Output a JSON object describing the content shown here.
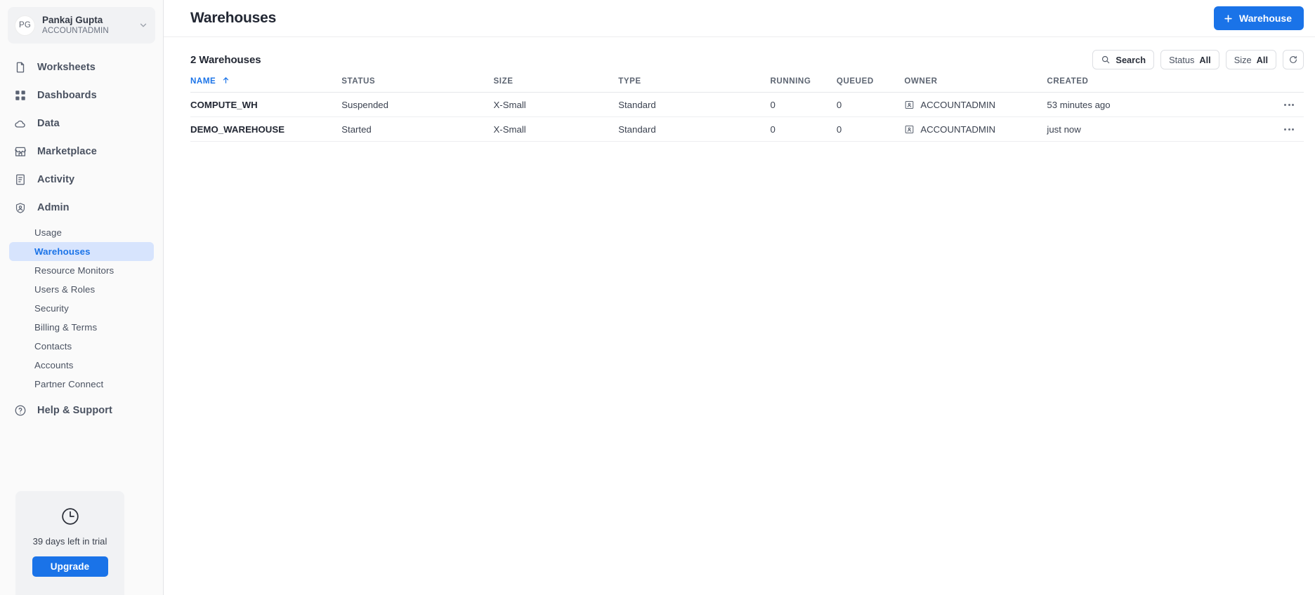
{
  "sidebar": {
    "account": {
      "initials": "PG",
      "name": "Pankaj Gupta",
      "role": "ACCOUNTADMIN",
      "chevron_icon": "chevron-down-icon"
    },
    "nav": [
      {
        "label": "Worksheets",
        "icon": "document-icon"
      },
      {
        "label": "Dashboards",
        "icon": "grid-icon"
      },
      {
        "label": "Data",
        "icon": "cloud-icon"
      },
      {
        "label": "Marketplace",
        "icon": "storefront-icon"
      },
      {
        "label": "Activity",
        "icon": "list-document-icon"
      },
      {
        "label": "Admin",
        "icon": "shield-user-icon"
      }
    ],
    "subnav": [
      {
        "label": "Usage",
        "active": false
      },
      {
        "label": "Warehouses",
        "active": true
      },
      {
        "label": "Resource Monitors",
        "active": false
      },
      {
        "label": "Users & Roles",
        "active": false
      },
      {
        "label": "Security",
        "active": false
      },
      {
        "label": "Billing & Terms",
        "active": false
      },
      {
        "label": "Contacts",
        "active": false
      },
      {
        "label": "Accounts",
        "active": false
      },
      {
        "label": "Partner Connect",
        "active": false
      }
    ],
    "help": {
      "label": "Help & Support",
      "icon": "question-circle-icon"
    },
    "trial": {
      "icon": "clock-icon",
      "text": "39 days left in trial",
      "button_label": "Upgrade"
    }
  },
  "header": {
    "title": "Warehouses",
    "add_button_label": "Warehouse",
    "add_button_icon": "plus-icon"
  },
  "toolbar": {
    "count_label": "2 Warehouses",
    "search_label": "Search",
    "search_icon": "search-icon",
    "status_filter_label": "Status",
    "status_filter_value": "All",
    "size_filter_label": "Size",
    "size_filter_value": "All",
    "refresh_icon": "refresh-icon"
  },
  "table": {
    "columns": [
      {
        "key": "name",
        "label": "NAME",
        "sorted": true,
        "sort_dir": "asc"
      },
      {
        "key": "status",
        "label": "STATUS",
        "sorted": false
      },
      {
        "key": "size",
        "label": "SIZE",
        "sorted": false
      },
      {
        "key": "type",
        "label": "TYPE",
        "sorted": false
      },
      {
        "key": "running",
        "label": "RUNNING",
        "sorted": false
      },
      {
        "key": "queued",
        "label": "QUEUED",
        "sorted": false
      },
      {
        "key": "owner",
        "label": "OWNER",
        "sorted": false
      },
      {
        "key": "created",
        "label": "CREATED",
        "sorted": false
      }
    ],
    "owner_icon": "id-badge-icon",
    "row_menu_icon": "kebab-menu-icon",
    "rows": [
      {
        "name": "COMPUTE_WH",
        "status": "Suspended",
        "size": "X-Small",
        "type": "Standard",
        "running": "0",
        "queued": "0",
        "owner": "ACCOUNTADMIN",
        "created": "53 minutes ago"
      },
      {
        "name": "DEMO_WAREHOUSE",
        "status": "Started",
        "size": "X-Small",
        "type": "Standard",
        "running": "0",
        "queued": "0",
        "owner": "ACCOUNTADMIN",
        "created": "just now"
      }
    ]
  },
  "colors": {
    "accent": "#1A73E8",
    "active_nav_bg": "#D7E4FD",
    "sidebar_bg": "#FAFAFA",
    "text_primary": "#222733",
    "text_secondary": "#5D6572"
  }
}
